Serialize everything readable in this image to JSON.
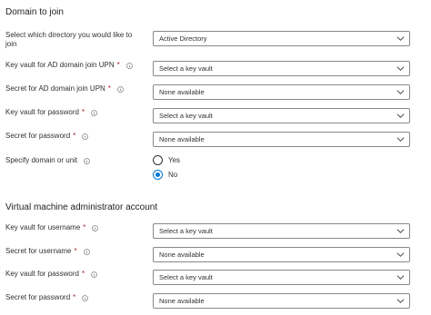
{
  "section_domain": {
    "title": "Domain to join",
    "directory_label": "Select which directory you would like to join",
    "directory_value": "Active Directory",
    "fields": [
      {
        "label": "Key vault for AD domain join UPN",
        "required": true,
        "value": "Select a key vault"
      },
      {
        "label": "Secret for AD domain join UPN",
        "required": true,
        "value": "None available"
      },
      {
        "label": "Key vault for password",
        "required": true,
        "value": "Select a key vault"
      },
      {
        "label": "Secret for password",
        "required": true,
        "value": "None available"
      }
    ],
    "unit_label": "Specify domain or unit",
    "unit_options": [
      {
        "label": "Yes",
        "selected": false
      },
      {
        "label": "No",
        "selected": true
      }
    ]
  },
  "section_admin": {
    "title": "Virtual machine administrator account",
    "fields": [
      {
        "label": "Key vault for username",
        "required": true,
        "value": "Select a key vault"
      },
      {
        "label": "Secret for username",
        "required": true,
        "value": "None available"
      },
      {
        "label": "Key vault for password",
        "required": true,
        "value": "Select a key vault"
      },
      {
        "label": "Secret for password",
        "required": true,
        "value": "None available"
      }
    ]
  },
  "required_marker": "*",
  "icons": {
    "info": "info-icon",
    "dropdown": "chevron-down-icon"
  },
  "colors": {
    "required": "#a4262c",
    "accent": "#0078d4",
    "border": "#8a8886"
  }
}
